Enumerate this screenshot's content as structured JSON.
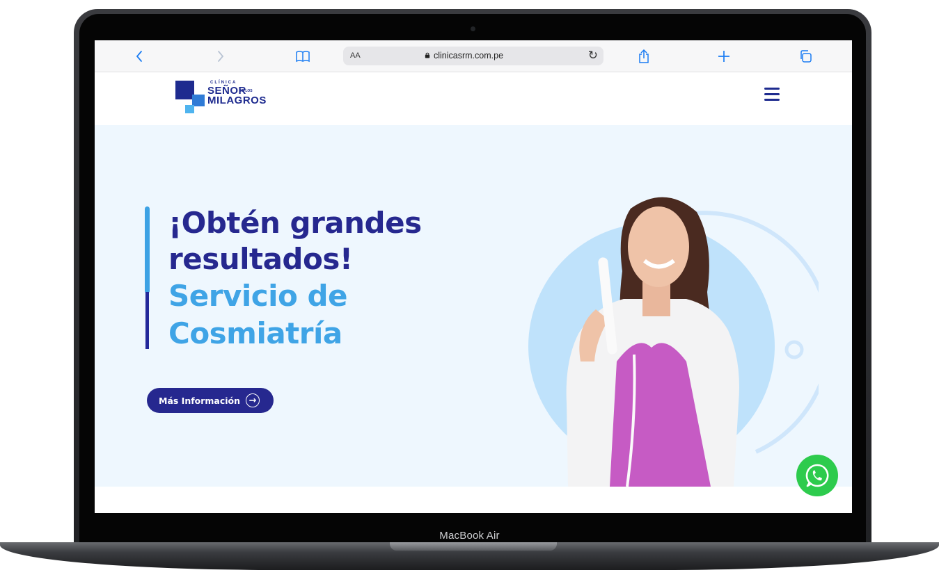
{
  "device": {
    "label": "MacBook Air"
  },
  "browser": {
    "url": "clinicasrm.com.pe",
    "reader_label": "AA",
    "icons": [
      "back-icon",
      "forward-icon",
      "bookmarks-icon",
      "lock-icon",
      "reload-icon",
      "share-icon",
      "new-tab-icon",
      "tabs-icon"
    ]
  },
  "site": {
    "logo": {
      "line1": "CLÍNICA",
      "line2": "SEÑOR",
      "line2b": "DE LOS",
      "line3": "MILAGROS"
    },
    "menu_icon": "hamburger-icon",
    "hero": {
      "title": "¡Obtén grandes resultados!",
      "subtitle": "Servicio de Cosmiatría",
      "cta_label": "Más Información",
      "cta_icon": "arrow-right-circle-icon"
    },
    "whatsapp_icon": "whatsapp-icon"
  },
  "colors": {
    "brand_dark": "#26288f",
    "brand_light": "#3fa4e6",
    "hero_bg": "#eef7fe",
    "whatsapp": "#2dcb4d",
    "safari_accent": "#1a7cf3"
  }
}
